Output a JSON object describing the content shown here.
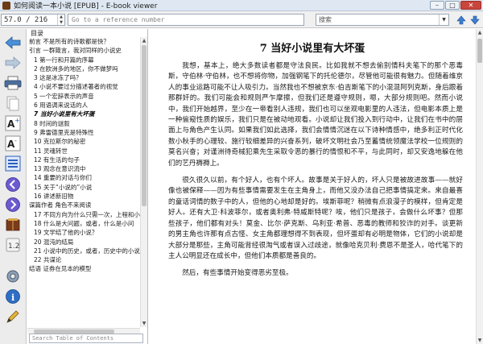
{
  "window": {
    "title": "如何阅读一本小说 [EPUB] - E-book viewer",
    "buttons": {
      "minimize": "–",
      "maximize": "□",
      "close": "✕"
    }
  },
  "toolbar": {
    "position": "57.0  /  216",
    "reference_placeholder": "Go to a reference number",
    "search_placeholder": "搜索",
    "find_prev_icon": "arrow-up-icon",
    "find_next_icon": "arrow-down-icon"
  },
  "side_toolbar": {
    "icons": [
      "back-arrow-icon",
      "forward-arrow-icon",
      "print-icon",
      "copy-icon",
      "font-larger-icon",
      "font-smaller-icon",
      "toc-icon",
      "previous-page-icon",
      "next-page-icon",
      "bookmark-icon",
      "reference-mode-icon",
      "preferences-icon",
      "info-icon",
      "pen-icon"
    ]
  },
  "toc": {
    "header": "目录",
    "items": [
      {
        "text": "前言 不是所有的诗歌都是快？",
        "level": 0
      },
      {
        "text": "引言 一群箴言，我对同样的小说史",
        "level": 0
      },
      {
        "text": "1 第一行和开篇的序幕",
        "level": 1
      },
      {
        "text": "2 在欧洲多的地区，你不做梦吗",
        "level": 1
      },
      {
        "text": "3 这是冰冻了吗？",
        "level": 1
      },
      {
        "text": "4 小说不要过分描述著者的视觉",
        "level": 1
      },
      {
        "text": "5 一个宏辞表示的声音",
        "level": 1
      },
      {
        "text": "6 用语调来说话的人",
        "level": 1
      },
      {
        "text": "7 当好小说里有大坏蛋",
        "level": 1,
        "active": true
      },
      {
        "text": "8 时间的谜叙",
        "level": 1
      },
      {
        "text": "9 弗雷德里克是特殊性",
        "level": 1
      },
      {
        "text": "10 克拉斯尔的秘密",
        "level": 1
      },
      {
        "text": "11 灵魂转世",
        "level": 1
      },
      {
        "text": "12 有生活的句子",
        "level": 1
      },
      {
        "text": "13 观念在意识流中",
        "level": 1
      },
      {
        "text": "14 重要的对话与你们",
        "level": 1
      },
      {
        "text": "15 关于“小说的”小说",
        "level": 1
      },
      {
        "text": "16 讲述新旧物",
        "level": 1
      },
      {
        "text": "谋篇作者 角色不来阅读",
        "level": 0
      },
      {
        "text": "17 不同方向为什么只需一次，上程和小",
        "level": 1
      },
      {
        "text": "18 什么是大问题，或者，什么是小问",
        "level": 1
      },
      {
        "text": "19 文学结了他的小说？",
        "level": 1
      },
      {
        "text": "20 混沌的结局",
        "level": 1
      },
      {
        "text": "21 小说中的历史，或者，历史中的小说",
        "level": 1
      },
      {
        "text": "22 共谋论",
        "level": 1
      },
      {
        "text": "结语 证券在见本的模型",
        "level": 0
      }
    ],
    "search_placeholder": "Search Table of Contents"
  },
  "chapter": {
    "title": "7 当好小说里有大坏蛋",
    "paragraphs": [
      "我想，基本上，绝大多数读者都是守法良民。比如我就不想去偷别情科夫笔下的那个恶毒斯，守伯林·守伯林，也不想将你物，加强钢笔下的托伦德尔，尽管他可能很有魅力。但随着维京人的事业运路可能不让人吸引力。当然我也不想被京东·伯吉斯笔下的小混混阿列克斯，身后跟着那群奸的。我们可能会和规则严乍摩擦，但我们还是遵守规则，嗯，大部分规则吧。然而小说中，我们开始越界，至少在一帝看别人违规，我们也可以坐观电影里的人违法，但电影本质上是一种偷窥性质的娱乐，我们只是在被动地观看。小说却让我们投入到行动中，让我们在书中的层面上与角色产生认同。如果我们如此选择，我们会情情沉迷在以下诗种情感中，绝多利正时代化数小秋手的心理较、施行较细差异的兴奋系列，破坏文明社会乃至蓄情统领魔法学校一位规则的莫名兴奋；对谨洲待奇械犯乘先生采取令恶的暴行的情恨和不平，与此同时，却又安逸地躲在他们的艺丹褥褥上。",
      "很久很久以前，有个好人，也有个坏人。故事是关于好人的，坏人只是被故进故事——就好像也被保释——因为有些事情需要发生在主角身上，而他又没办法自己把事情搞定来。来自最喜的童话词情的数子中的人，但他的心地却是好的。埃斯菲呢？稍微有点浪漫子的模样，但肯定是好人。还有大卫·科波菲尔，或者奥利弗·特威斯特呢？唉，他们只是孩子，会做什么坏事？但那些孩子，他们都有对头！莫金、比尔·萨克斯、乌利亚·希普、恶毒的教师和狡诈的对手。谈更新的男主角也许那有点古怪、女主角都理想得不到表现，但坏蛋却有必明是物体，它们的小说却是大部分是那些，主角可能背经很淘气或者误入过歧途，就像哈克贝利·费恩不是圣人，哈代笔下的主人公明显还在成长中，但他们本质都是善良的。",
      "然后，有些事情开始变得恶劣至极。"
    ]
  }
}
